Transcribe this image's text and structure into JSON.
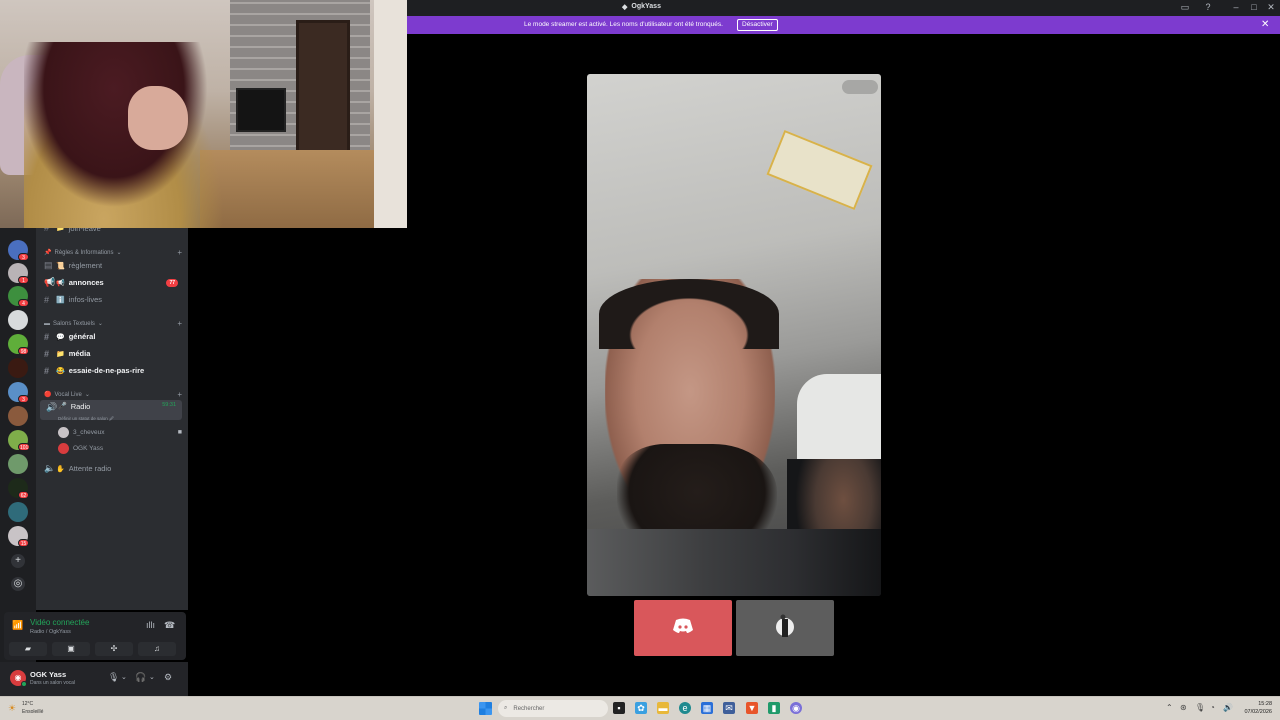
{
  "window": {
    "title": "OgkYass",
    "controls": {
      "inbox": "▭",
      "help": "?",
      "minimize": "–",
      "maximize": "□",
      "close": "✕"
    }
  },
  "banner": {
    "text": "Le mode streamer est activé. Les noms d'utilisateur ont été tronqués.",
    "button": "Désactiver",
    "close": "✕"
  },
  "server_badges": [
    "3",
    "1",
    "4",
    "",
    "98",
    "",
    "3",
    "",
    "101",
    "",
    "62",
    "",
    "15"
  ],
  "channels": {
    "truncated_top": "join-leave",
    "categories": [
      {
        "emoji": "📌",
        "label": "Règles & Informations"
      },
      {
        "emoji": "▬",
        "label": "Salons Textuels"
      },
      {
        "emoji": "🔴",
        "label": "Vocal Live"
      }
    ],
    "items": [
      {
        "emoji": "📜",
        "label": "règlement",
        "unread": false,
        "badge": ""
      },
      {
        "emoji": "📢",
        "label": "annonces",
        "unread": true,
        "badge": "77"
      },
      {
        "emoji": "ℹ️",
        "label": "infos-lives",
        "unread": false,
        "badge": ""
      },
      {
        "emoji": "💬",
        "label": "général",
        "unread": true,
        "badge": ""
      },
      {
        "emoji": "📁",
        "label": "média",
        "unread": true,
        "badge": ""
      },
      {
        "emoji": "😂",
        "label": "essaie-de-ne-pas-rire",
        "unread": true,
        "badge": ""
      }
    ],
    "voice_active": {
      "label": "Radio",
      "timer": "59:31",
      "sub": "Définir un statut de salon 🖉"
    },
    "voice_users": [
      "3_cheveux",
      "OGK Yass"
    ],
    "voice_other": {
      "label": "Attente radio"
    }
  },
  "voice_panel": {
    "status": "Vidéo connectée",
    "sub": "Radio / OgkYass"
  },
  "user_panel": {
    "name": "OGK Yass",
    "sub": "Dans un salon vocal"
  },
  "taskbar": {
    "weather_temp": "12°C",
    "weather_desc": "Ensoleillé",
    "search_placeholder": "Rechercher",
    "time": "15:28",
    "date": "07/02/2026"
  },
  "colors": {
    "banner": "#7d3bcf",
    "discord_red_tile": "#d9575b",
    "voice_green": "#23a55a",
    "badge_red": "#f23f43"
  }
}
